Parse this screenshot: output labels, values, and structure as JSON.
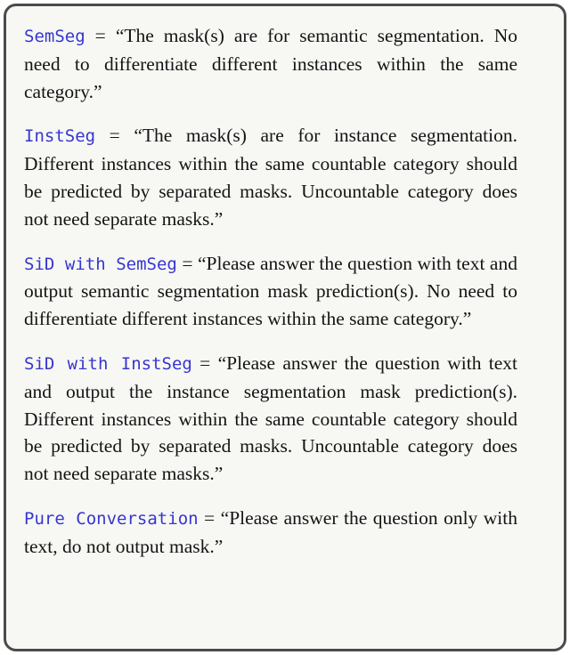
{
  "panel": {
    "background_color": "#f7f7f4",
    "border_color": "#4b4b4b",
    "token_color": "#3636cf",
    "text_color": "#141414"
  },
  "definitions": [
    {
      "token": "SemSeg",
      "equals": " = ",
      "text": "“The mask(s) are for semantic segmentation. No need to differentiate different instances within the same category.”"
    },
    {
      "token": "InstSeg",
      "equals": " = ",
      "text": "“The mask(s) are for instance segmentation. Different instances within the same countable category should be predicted by separated masks.  Uncountable category does not need separate masks.”"
    },
    {
      "token": "SiD with SemSeg",
      "equals": " = ",
      "text": "“Please answer the question with text and output semantic segmentation mask prediction(s). No need to differentiate different instances within the same category.”"
    },
    {
      "token": "SiD with InstSeg",
      "equals": " = ",
      "text": "“Please answer the question with text and output the instance segmentation mask prediction(s).  Different instances within the same countable category should be predicted by separated masks.  Uncountable category does not need separate masks.”"
    },
    {
      "token": "Pure Conversation",
      "equals": " = ",
      "text": "“Please answer the question only with text, do not output mask.”"
    }
  ]
}
